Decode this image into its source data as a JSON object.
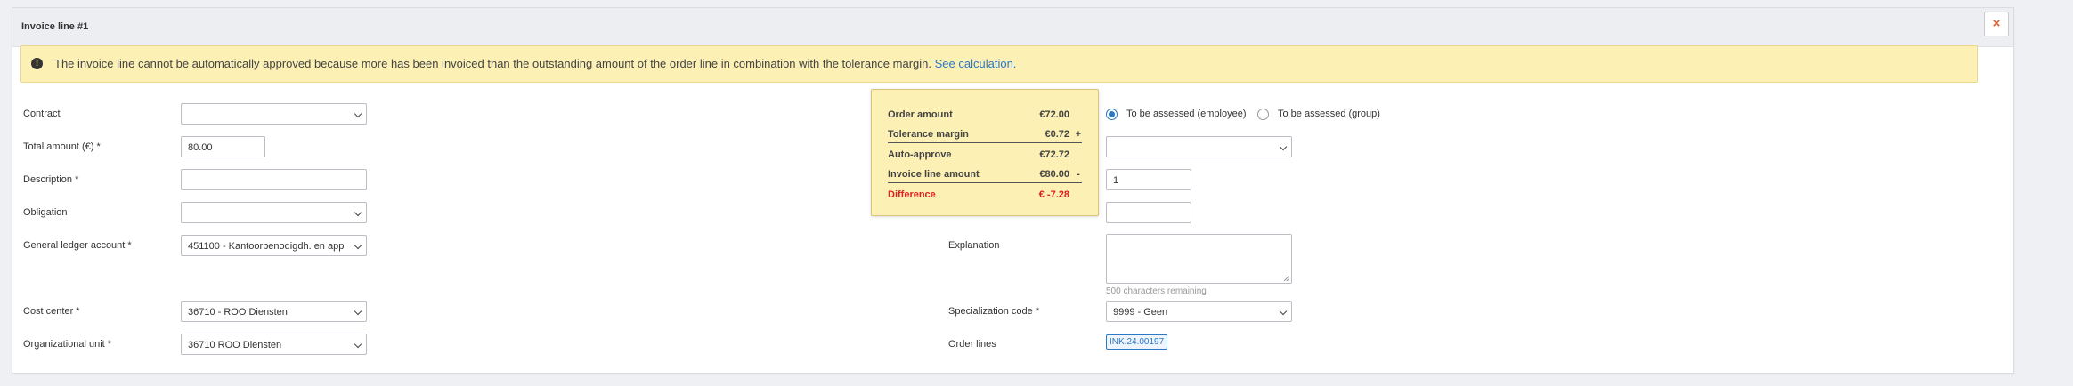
{
  "header": {
    "title": "Invoice line #1",
    "close_glyph": "×"
  },
  "alert": {
    "icon": "exclamation-circle-icon",
    "icon_glyph": "!",
    "text": "The invoice line cannot be automatically approved because more has been invoiced than the outstanding amount of the order line in combination with the tolerance margin.",
    "link": "See calculation."
  },
  "left": {
    "contract": {
      "label": "Contract",
      "value": ""
    },
    "total_amount": {
      "label": "Total amount (€) *",
      "value": "80.00"
    },
    "description": {
      "label": "Description *",
      "value": ""
    },
    "obligation": {
      "label": "Obligation",
      "value": ""
    },
    "gl_account": {
      "label": "General ledger account *",
      "value": "451100  - Kantoorbenodigdh. en app"
    },
    "cost_center": {
      "label": "Cost center *",
      "value": "36710 - ROO Diensten"
    },
    "org_unit": {
      "label": "Organizational unit *",
      "value": "36710 ROO Diensten"
    }
  },
  "right": {
    "assess_employee": {
      "label": "To be assessed (employee)",
      "checked": true
    },
    "assess_group": {
      "label": "To be assessed (group)",
      "checked": false
    },
    "select_row2": {
      "value": ""
    },
    "quantity": {
      "value": "1"
    },
    "row4_input": {
      "value": ""
    },
    "explanation": {
      "label": "Explanation",
      "hint": "500 characters remaining"
    },
    "specialization": {
      "label": "Specialization code  *",
      "value": "9999 - Geen"
    },
    "order_lines": {
      "label": "Order lines",
      "tag": "INK.24.00197"
    }
  },
  "calculation": {
    "rows": [
      {
        "label": "Order amount",
        "value": "€72.00",
        "op": ""
      },
      {
        "label": "Tolerance margin",
        "value": "€0.72",
        "op": "+"
      },
      {
        "label": "Auto-approve",
        "value": "€72.72",
        "op": ""
      },
      {
        "label": "Invoice line amount",
        "value": "€80.00",
        "op": "-"
      },
      {
        "label": "Difference",
        "value": "€ -7.28",
        "op": ""
      }
    ],
    "difference_color": "#e02020"
  },
  "colors": {
    "alert_bg": "#fcf0b5",
    "link": "#2b78c5",
    "close": "#e45a28"
  }
}
